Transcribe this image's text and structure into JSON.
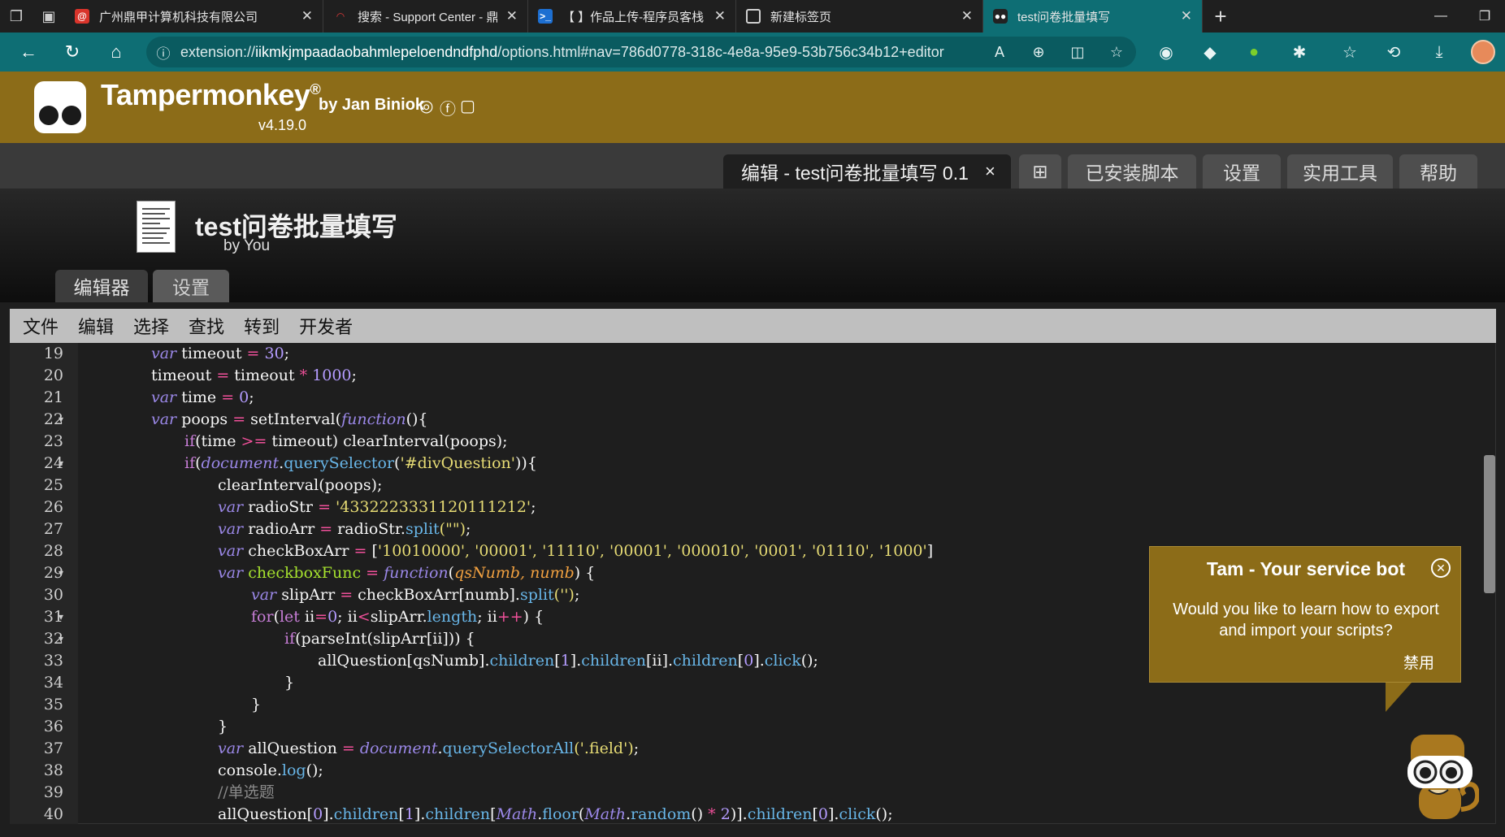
{
  "browser": {
    "tabs": [
      {
        "title": "广州鼎甲计算机科技有限公司",
        "favicon": "at-sign-icon"
      },
      {
        "title": "搜索 - Support Center - 鼎甲项目",
        "favicon": "support-icon"
      },
      {
        "title": "【        】作品上传-程序员客栈",
        "favicon": "terminal-icon"
      },
      {
        "title": "新建标签页",
        "favicon": "newtab-icon"
      },
      {
        "title": "test问卷批量填写",
        "favicon": "tampermonkey-icon"
      }
    ],
    "address": {
      "prefix": "extension://",
      "host": "iikmkjmpaadaobahmlepeloendndfphd",
      "path": "/options.html#nav=786d0778-318c-4e8a-95e9-53b756c34b12+editor"
    }
  },
  "tm": {
    "brand": "Tampermonkey",
    "registered": "®",
    "byline": "by Jan Biniok",
    "version": "v4.19.0",
    "tabs": {
      "edit": "编辑 - test问卷批量填写 0.1",
      "close": "×",
      "add": "⊞",
      "installed": "已安装脚本",
      "settings": "设置",
      "utilities": "实用工具",
      "help": "帮助"
    }
  },
  "script": {
    "title": "test问卷批量填写",
    "author": "by You",
    "tabs": {
      "editor": "编辑器",
      "settings": "设置"
    }
  },
  "editor": {
    "menu": [
      "文件",
      "编辑",
      "选择",
      "查找",
      "转到",
      "开发者"
    ],
    "lines": [
      {
        "n": "19",
        "fold": false
      },
      {
        "n": "20",
        "fold": false
      },
      {
        "n": "21",
        "fold": false
      },
      {
        "n": "22",
        "fold": true
      },
      {
        "n": "23",
        "fold": false
      },
      {
        "n": "24",
        "fold": true
      },
      {
        "n": "25",
        "fold": false
      },
      {
        "n": "26",
        "fold": false
      },
      {
        "n": "27",
        "fold": false
      },
      {
        "n": "28",
        "fold": false
      },
      {
        "n": "29",
        "fold": true
      },
      {
        "n": "30",
        "fold": false
      },
      {
        "n": "31",
        "fold": true
      },
      {
        "n": "32",
        "fold": true
      },
      {
        "n": "33",
        "fold": false
      },
      {
        "n": "34",
        "fold": false
      },
      {
        "n": "35",
        "fold": false
      },
      {
        "n": "36",
        "fold": false
      },
      {
        "n": "37",
        "fold": false
      },
      {
        "n": "38",
        "fold": false
      },
      {
        "n": "39",
        "fold": false
      },
      {
        "n": "40",
        "fold": false
      }
    ],
    "code": {
      "l19_var": "var",
      "l19_rest": " timeout ",
      "l19_op": "=",
      "l19_num": " 30",
      "l19_end": ";",
      "l20_a": "timeout ",
      "l20_op": "=",
      "l20_b": " timeout ",
      "l20_op2": "*",
      "l20_num": " 1000",
      "l20_end": ";",
      "l21_var": "var",
      "l21_rest": " time ",
      "l21_op": "=",
      "l21_num": " 0",
      "l21_end": ";",
      "l22_var": "var",
      "l22_a": " poops ",
      "l22_op": "=",
      "l22_b": " setInterval(",
      "l22_fn": "function",
      "l22_c": "(){",
      "l23_if": "if",
      "l23_a": "(time ",
      "l23_op": ">=",
      "l23_b": " timeout) clearInterval(poops);",
      "l24_if": "if",
      "l24_a": "(",
      "l24_doc": "document",
      "l24_b": ".",
      "l24_qs": "querySelector",
      "l24_c": "(",
      "l24_s": "'#divQuestion'",
      "l24_d": ")){",
      "l25": "clearInterval(poops);",
      "l26_var": "var",
      "l26_a": " radioStr ",
      "l26_op": "=",
      "l26_s": " '4332223331120111212'",
      "l26_end": ";",
      "l27_var": "var",
      "l27_a": " radioArr ",
      "l27_op": "=",
      "l27_b": " radioStr.",
      "l27_p": "split",
      "l27_s": "(\"\")",
      "l27_end": ";",
      "l28_var": "var",
      "l28_a": " checkBoxArr ",
      "l28_op": "=",
      "l28_b": " [",
      "l28_s": "'10010000', '00001', '11110', '00001', '000010', '0001', '01110', '1000'",
      "l28_end": "]",
      "l29_var": "var",
      "l29_name": " checkboxFunc",
      "l29_op": " =",
      "l29_fn": " function",
      "l29_a": "(",
      "l29_args": "qsNumb, numb",
      "l29_b": ") {",
      "l30_var": "var",
      "l30_a": " slipArr ",
      "l30_op": "=",
      "l30_b": " checkBoxArr[numb].",
      "l30_p": "split",
      "l30_s": "('')",
      "l30_end": ";",
      "l31_for": "for",
      "l31_a": "(",
      "l31_let": "let",
      "l31_b": " ii",
      "l31_op": "=",
      "l31_num": "0",
      "l31_c": "; ii",
      "l31_op2": "<",
      "l31_d": "slipArr.",
      "l31_p": "length",
      "l31_e": "; ii",
      "l31_op3": "++",
      "l31_f": ") {",
      "l32_if": "if",
      "l32_a": "(parseInt(slipArr[ii])) {",
      "l33_a": "allQuestion[qsNumb].",
      "l33_p1": "children",
      "l33_b": "[",
      "l33_n1": "1",
      "l33_c": "].",
      "l33_p2": "children",
      "l33_d": "[ii].",
      "l33_p3": "children",
      "l33_e": "[",
      "l33_n2": "0",
      "l33_f": "].",
      "l33_p4": "click",
      "l33_g": "();",
      "l34": "}",
      "l35": "}",
      "l36": "}",
      "l37_var": "var",
      "l37_a": " allQuestion ",
      "l37_op": "=",
      "l37_doc": " document",
      "l37_b": ".",
      "l37_p": "querySelectorAll",
      "l37_s": "('.field')",
      "l37_end": ";",
      "l38_a": "console.",
      "l38_p": "log",
      "l38_b": "();",
      "l39": "//单选题",
      "l40_a": "allQuestion[",
      "l40_n1": "0",
      "l40_b": "].",
      "l40_p1": "children",
      "l40_c": "[",
      "l40_n2": "1",
      "l40_d": "].",
      "l40_p2": "children",
      "l40_e": "[",
      "l40_math": "Math",
      "l40_f": ".",
      "l40_p3": "floor",
      "l40_g": "(",
      "l40_math2": "Math",
      "l40_h": ".",
      "l40_p4": "random",
      "l40_i": "() ",
      "l40_op": "*",
      "l40_n3": " 2",
      "l40_j": ")].",
      "l40_p5": "children",
      "l40_k": "[",
      "l40_n4": "0",
      "l40_l": "].",
      "l40_p6": "click",
      "l40_m": "();"
    }
  },
  "tambot": {
    "title": "Tam - Your service bot",
    "message": "Would you like to learn how to export and import your scripts?",
    "disable": "禁用"
  },
  "colors": {
    "tm_brand": "#8c6c18",
    "browser_accent": "#0e6e74"
  }
}
